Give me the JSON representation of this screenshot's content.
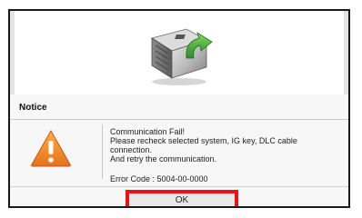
{
  "dialog": {
    "title": "Notice",
    "icon": "warning-icon",
    "message_lines": [
      "Communication Fail!",
      "Please recheck selected system, IG key, DLC cable",
      "connection.",
      "And retry the communication."
    ],
    "error_code": "Error Code : 5004-00-0000",
    "ok_label": "OK"
  },
  "header_image": {
    "icon": "ecu-module-with-green-arrow-icon"
  },
  "colors": {
    "highlight_border": "#ee1111",
    "warning_fill": "#f08a18",
    "arrow_green": "#3aa63a"
  }
}
